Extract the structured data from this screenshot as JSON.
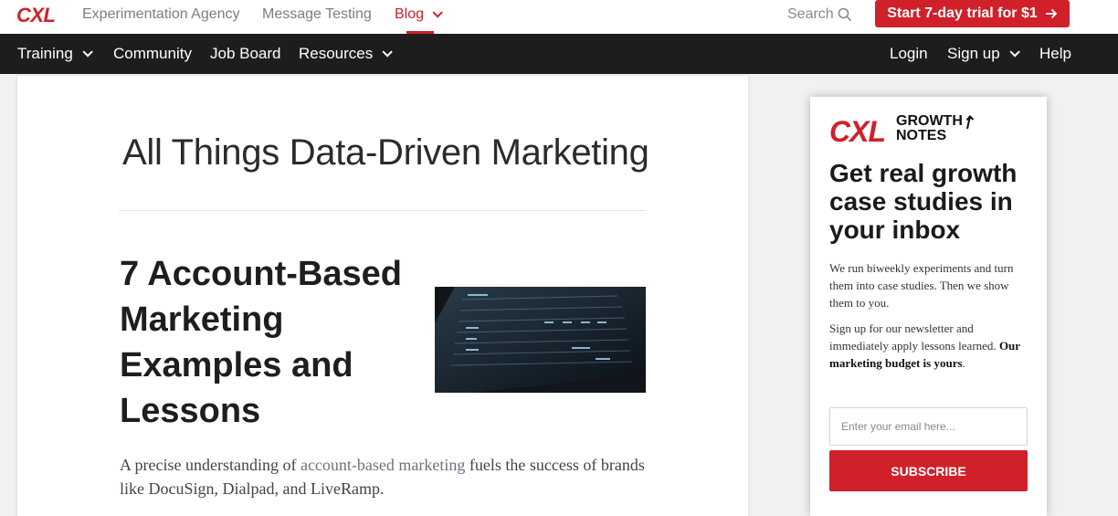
{
  "topbar": {
    "logo": "CXL",
    "links": [
      "Experimentation Agency",
      "Message Testing",
      "Blog"
    ],
    "search_label": "Search",
    "trial_button": "Start 7-day trial for $1"
  },
  "navbar": {
    "left": [
      {
        "label": "Training",
        "dropdown": true
      },
      {
        "label": "Community",
        "dropdown": false
      },
      {
        "label": "Job Board",
        "dropdown": false
      },
      {
        "label": "Resources",
        "dropdown": true
      }
    ],
    "right": [
      {
        "label": "Login",
        "dropdown": false
      },
      {
        "label": "Sign up",
        "dropdown": true
      },
      {
        "label": "Help",
        "dropdown": false
      }
    ]
  },
  "main": {
    "section_title": "All Things Data-Driven Marketing",
    "article_title": "7 Account-Based Marketing Examples and Lessons",
    "excerpt_before": "A precise understanding of ",
    "excerpt_link": "account-based marketing",
    "excerpt_after": " fuels the success of brands like DocuSign, Dialpad, and LiveRamp."
  },
  "sidebar": {
    "logo": "CXL",
    "growth_line1": "GROWTH",
    "growth_line2": "NOTES",
    "heading": "Get real growth case studies in your inbox",
    "p1": "We run biweekly experiments and turn them into case studies. Then we show them to you.",
    "p2_before": "Sign up for our newsletter and immediately apply lessons learned. ",
    "p2_bold": "Our marketing budget is yours",
    "p2_after": ".",
    "email_placeholder": "Enter your email here...",
    "subscribe_button": "SUBSCRIBE"
  },
  "colors": {
    "brand_red": "#d0202a",
    "nav_bg": "#1d1d1d",
    "page_bg": "#f1f1f1"
  }
}
